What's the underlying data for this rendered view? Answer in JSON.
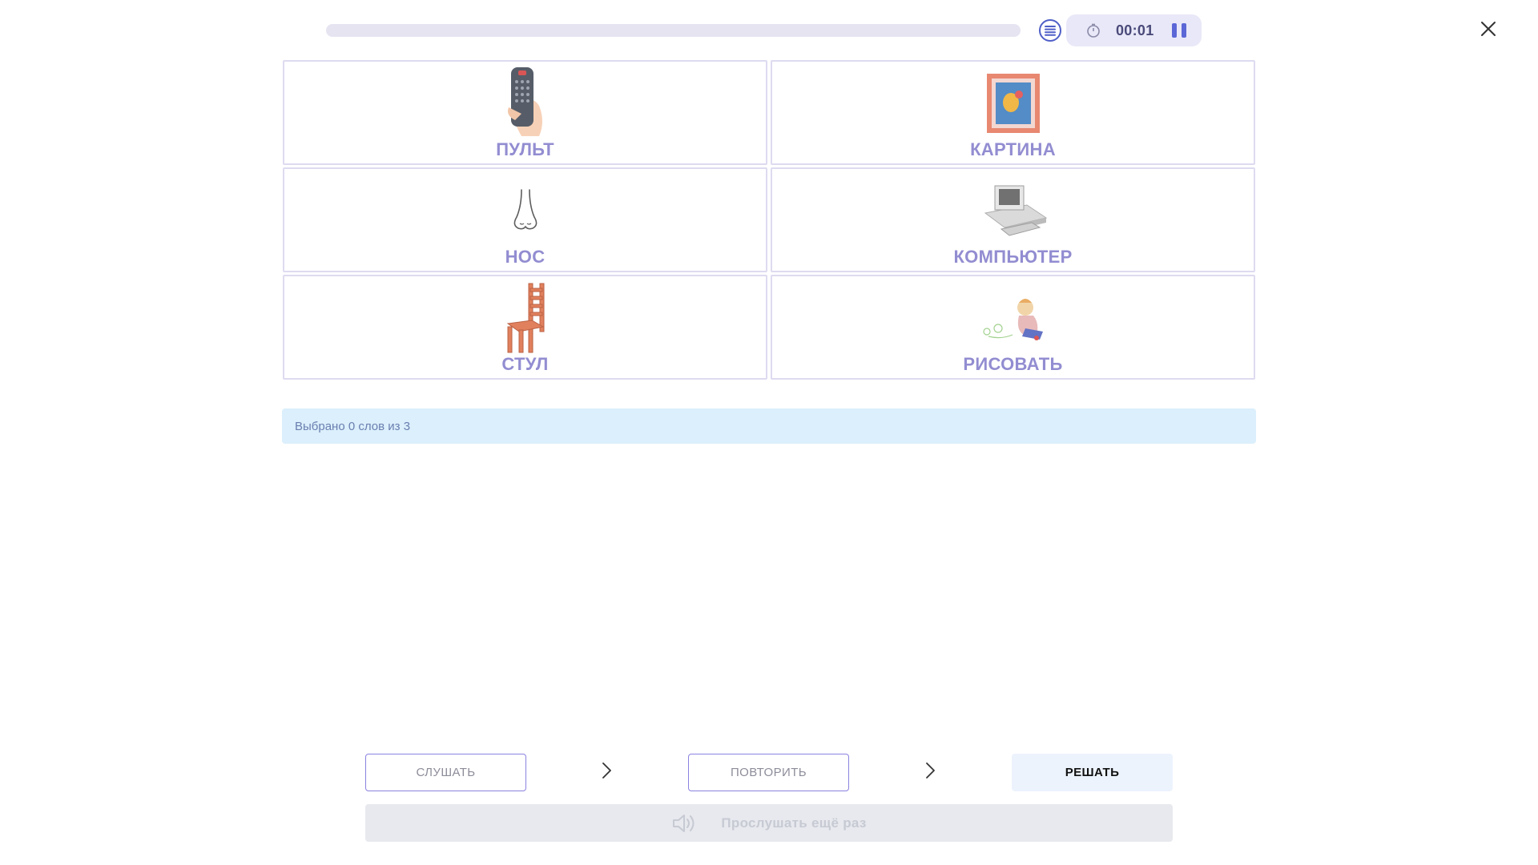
{
  "header": {
    "progress": 0,
    "timer": "00:01",
    "icons": {
      "list": "list-icon",
      "clock": "clock-icon",
      "pause": "pause-icon",
      "close": "close-icon"
    }
  },
  "cards": [
    {
      "word": "ПУЛЬТ",
      "icon": "remote-control-icon"
    },
    {
      "word": "КАРТИНА",
      "icon": "framed-picture-icon"
    },
    {
      "word": "НОС",
      "icon": "nose-icon"
    },
    {
      "word": "КОМПЬЮТЕР",
      "icon": "computer-icon"
    },
    {
      "word": "СТУЛ",
      "icon": "chair-icon"
    },
    {
      "word": "РИСОВАТЬ",
      "icon": "drawing-child-icon"
    }
  ],
  "info": {
    "selected_text": "Выбрано 0 слов из 3"
  },
  "controls": {
    "listen_label": "СЛУШАТЬ",
    "repeat_label": "ПОВТОРИТЬ",
    "solve_label": "РЕШАТЬ",
    "replay_label": "Прослушать ещё раз"
  },
  "colors": {
    "accent": "#5b67d6",
    "word": "#8d87cf",
    "info_bg": "#dbeffc",
    "solve_bg": "#edf3fd"
  }
}
